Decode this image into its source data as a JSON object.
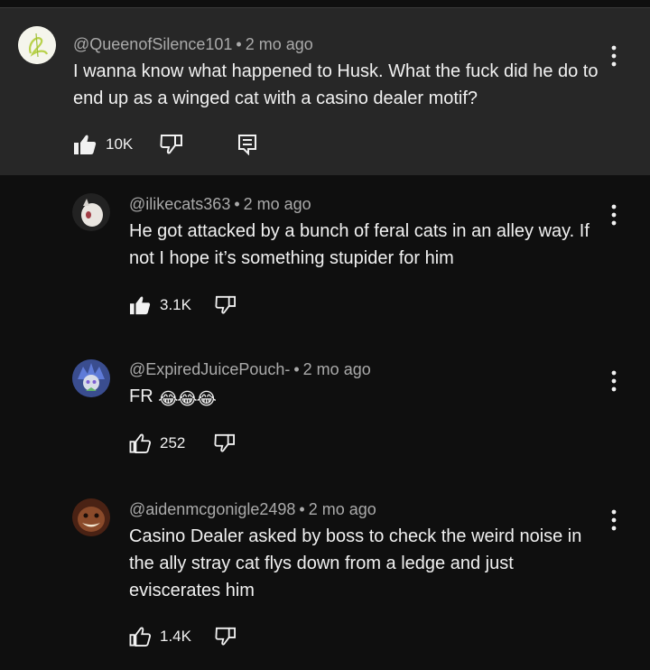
{
  "comments": [
    {
      "handle": "@QueenofSilence101",
      "time": "2 mo ago",
      "text": "I wanna know what happened to Husk. What the fuck did he do to end up as a winged cat with a casino dealer motif?",
      "likes": "10K",
      "liked": true
    },
    {
      "handle": "@ilikecats363",
      "time": "2 mo ago",
      "text": "He got attacked by a bunch of feral cats in an alley way. If not I hope it’s something stupider for him",
      "likes": "3.1K",
      "liked": true
    },
    {
      "handle": "@ExpiredJuicePouch-",
      "time": "2 mo ago",
      "text": "FR",
      "emoji": "😂😂😂",
      "likes": "252",
      "liked": false
    },
    {
      "handle": "@aidenmcgonigle2498",
      "time": "2 mo ago",
      "text": "Casino Dealer asked by boss to check the weird noise in the ally stray cat flys down from a ledge and just eviscerates him",
      "likes": "1.4K",
      "liked": false
    }
  ],
  "meta_separator": "•",
  "icons": {
    "like": "thumbs-up-icon",
    "dislike": "thumbs-down-icon",
    "replies": "reply-comment-icon",
    "menu": "more-vertical-icon"
  }
}
